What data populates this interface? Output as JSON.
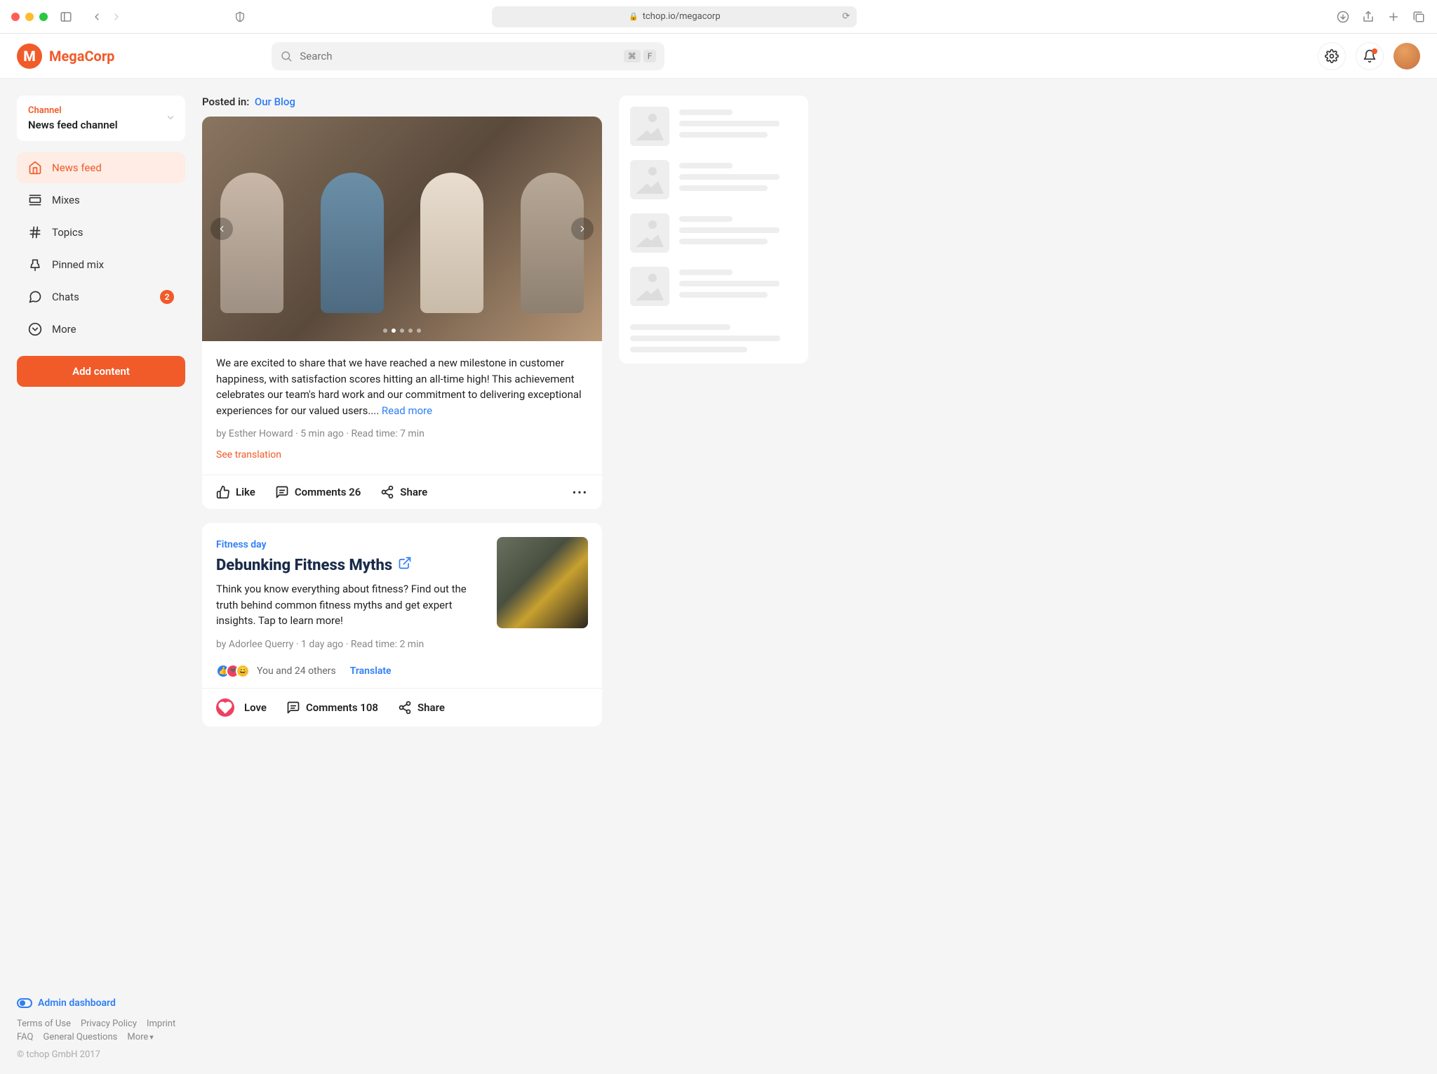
{
  "browser": {
    "url": "tchop.io/megacorp"
  },
  "brand": {
    "name": "MegaCorp",
    "initial": "M"
  },
  "search": {
    "placeholder": "Search",
    "kbd1": "⌘",
    "kbd2": "F"
  },
  "channel": {
    "label": "Channel",
    "name": "News feed channel"
  },
  "nav": {
    "newsfeed": "News feed",
    "mixes": "Mixes",
    "topics": "Topics",
    "pinned": "Pinned mix",
    "chats": "Chats",
    "chats_badge": "2",
    "more": "More"
  },
  "add_content": "Add content",
  "posted_in_label": "Posted in:",
  "posted_in_link": "Our Blog",
  "post1": {
    "text": "We are excited to share that we have reached a new milestone in customer happiness, with satisfaction scores hitting an all-time high! This achievement celebrates our team's hard work and our commitment to delivering exceptional experiences for our valued users....",
    "read_more": " Read more",
    "meta": "by Esther Howard · 5 min ago · Read time: 7 min",
    "see_translation": "See translation",
    "like": "Like",
    "comments": "Comments 26",
    "share": "Share"
  },
  "post2": {
    "tag": "Fitness day",
    "title": "Debunking Fitness Myths",
    "desc": "Think you know everything about fitness? Find out the truth behind common fitness myths and get expert insights. Tap to learn more!",
    "meta": "by Adorlee Querry · 1 day ago · Read time: 2 min",
    "reactions_text": "You and 24 others",
    "translate": "Translate",
    "love": "Love",
    "comments": "Comments 108",
    "share": "Share"
  },
  "footer": {
    "admin": "Admin dashboard",
    "terms": "Terms of Use",
    "privacy": "Privacy Policy",
    "imprint": "Imprint",
    "faq": "FAQ",
    "general": "General Questions",
    "more": "More",
    "copyright": "© tchop GmbH 2017"
  }
}
